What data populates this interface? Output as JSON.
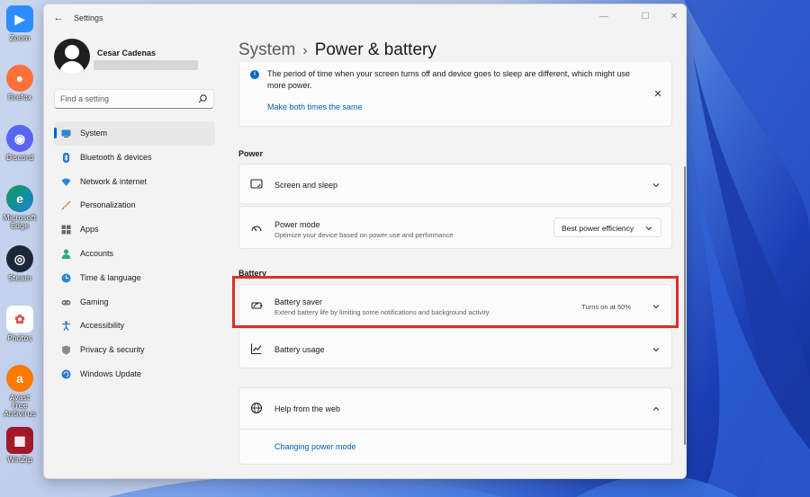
{
  "desktop": {
    "icons": [
      {
        "label": "Zoom",
        "icon": "zoom-icon",
        "color": "#2d8cff",
        "glyph": "▶"
      },
      {
        "label": "Firefox",
        "icon": "firefox-icon",
        "color": "#ff7139",
        "glyph": "●"
      },
      {
        "label": "Discord",
        "icon": "discord-icon",
        "color": "#5865f2",
        "glyph": "◉"
      },
      {
        "label": "Microsoft Edge",
        "icon": "edge-icon",
        "color": "#0f9d58",
        "glyph": "e"
      },
      {
        "label": "Steam",
        "icon": "steam-icon",
        "color": "#1b2838",
        "glyph": "◎"
      },
      {
        "label": "Photos",
        "icon": "photos-icon",
        "color": "#ffffff",
        "glyph": "✿"
      },
      {
        "label": "Avast Free Antivirus",
        "icon": "avast-icon",
        "color": "#ff7800",
        "glyph": "a"
      },
      {
        "label": "WinZip",
        "icon": "winzip-icon",
        "color": "#a3192b",
        "glyph": "▦"
      }
    ]
  },
  "window": {
    "title": "Settings",
    "controls": {
      "minimize": "—",
      "maximize": "☐",
      "close": "✕"
    }
  },
  "profile": {
    "name": "Cesar Cadenas"
  },
  "search": {
    "placeholder": "Find a setting"
  },
  "sidebar": {
    "items": [
      {
        "label": "System",
        "icon": "system-icon",
        "active": true
      },
      {
        "label": "Bluetooth & devices",
        "icon": "bluetooth-icon"
      },
      {
        "label": "Network & internet",
        "icon": "wifi-icon"
      },
      {
        "label": "Personalization",
        "icon": "brush-icon"
      },
      {
        "label": "Apps",
        "icon": "apps-icon"
      },
      {
        "label": "Accounts",
        "icon": "person-icon"
      },
      {
        "label": "Time & language",
        "icon": "globe-clock-icon"
      },
      {
        "label": "Gaming",
        "icon": "gamepad-icon"
      },
      {
        "label": "Accessibility",
        "icon": "accessibility-icon"
      },
      {
        "label": "Privacy & security",
        "icon": "shield-icon"
      },
      {
        "label": "Windows Update",
        "icon": "update-icon"
      }
    ]
  },
  "breadcrumb": {
    "parent": "System",
    "separator": "›",
    "current": "Power & battery"
  },
  "info": {
    "text": "The period of time when your screen turns off and device goes to sleep are different, which might use more power.",
    "link": "Make both times the same"
  },
  "power": {
    "header": "Power",
    "screen_sleep": {
      "title": "Screen and sleep"
    },
    "power_mode": {
      "title": "Power mode",
      "description": "Optimize your device based on power use and performance",
      "value": "Best power efficiency"
    }
  },
  "battery": {
    "header": "Battery",
    "saver": {
      "title": "Battery saver",
      "description": "Extend battery life by limiting some notifications and background activity",
      "status": "Turns on at 50%"
    },
    "usage": {
      "title": "Battery usage"
    }
  },
  "help": {
    "title": "Help from the web",
    "link": "Changing power mode"
  },
  "colors": {
    "accent": "#0067c0",
    "highlight": "#d9302a"
  }
}
